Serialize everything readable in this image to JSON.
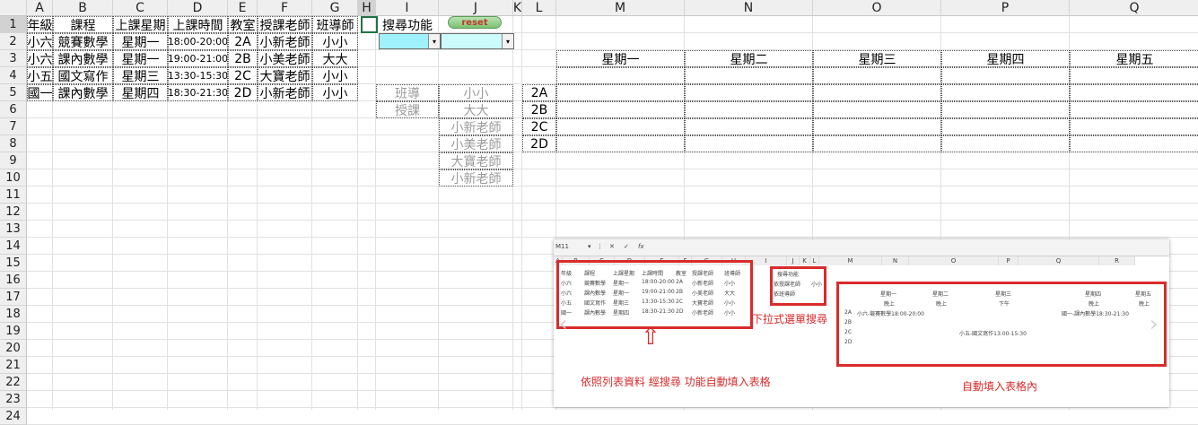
{
  "columns": [
    "A",
    "B",
    "C",
    "D",
    "E",
    "F",
    "G",
    "H",
    "I",
    "J",
    "K",
    "L",
    "M",
    "N",
    "O",
    "P",
    "Q"
  ],
  "rows": [
    "1",
    "2",
    "3",
    "4",
    "5",
    "6",
    "7",
    "8",
    "9",
    "10",
    "11",
    "12",
    "13",
    "14",
    "15",
    "16",
    "17",
    "18",
    "19",
    "20",
    "21",
    "22",
    "23",
    "24"
  ],
  "table": {
    "headers": [
      "年級",
      "課程",
      "上課星期",
      "上課時間",
      "教室",
      "授課老師",
      "班導師"
    ],
    "rows": [
      [
        "小六",
        "競賽數學",
        "星期一",
        "18:00-20:00",
        "2A",
        "小新老師",
        "小小"
      ],
      [
        "小六",
        "課內數學",
        "星期一",
        "19:00-21:00",
        "2B",
        "小美老師",
        "大大"
      ],
      [
        "小五",
        "國文寫作",
        "星期三",
        "13:30-15:30",
        "2C",
        "大寶老師",
        "小小"
      ],
      [
        "國一",
        "課內數學",
        "星期四",
        "18:30-21:30",
        "2D",
        "小新老師",
        "小小"
      ]
    ]
  },
  "search": {
    "label": "搜尋功能",
    "reset_label": "reset",
    "dropdown_arrow": "▾"
  },
  "lists": {
    "types": [
      "班導",
      "授課"
    ],
    "teachers": [
      "小小",
      "大大",
      "小新老師",
      "小美老師",
      "大寶老師",
      "小新老師"
    ]
  },
  "schedule": {
    "days": [
      "星期一",
      "星期二",
      "星期三",
      "星期四",
      "星期五"
    ],
    "rooms": [
      "2A",
      "2B",
      "2C",
      "2D"
    ]
  },
  "inset": {
    "name_box": "M11",
    "formula_icons": [
      "▾",
      "⋮",
      "✕",
      "✓",
      "fx"
    ],
    "col_headers": [
      "A",
      "B",
      "C",
      "D",
      "E",
      "F",
      "G",
      "H",
      "I",
      "J",
      "K",
      "L",
      "M",
      "N",
      "O",
      "P",
      "Q",
      "R"
    ],
    "table_headers": [
      "年級",
      "課程",
      "上課星期",
      "上課時間",
      "教室",
      "授課老師",
      "班導師"
    ],
    "table_rows": [
      [
        "小六",
        "競賽數學",
        "星期一",
        "18:00-20:00",
        "2A",
        "小新老師",
        "小小"
      ],
      [
        "小六",
        "課內數學",
        "星期一",
        "19:00-21:00",
        "2B",
        "小美老師",
        "大大"
      ],
      [
        "小五",
        "國文寫作",
        "星期三",
        "13:30-15:30",
        "2C",
        "大寶老師",
        "小小"
      ],
      [
        "國一",
        "課內數學",
        "星期四",
        "18:30-21:30",
        "2D",
        "小新老師",
        "小小"
      ]
    ],
    "search_label": "搜尋功能",
    "search_row1": [
      "依授課老師",
      "小小"
    ],
    "search_row2": "依班導師",
    "days": [
      "星期一",
      "星期二",
      "星期三",
      "星期四",
      "星期五"
    ],
    "periods": [
      "晚上",
      "晚上",
      "下午",
      "晚上",
      "晚上"
    ],
    "rooms": [
      "2A",
      "2B",
      "2C",
      "2D"
    ],
    "entry_2a": "小六-競賽數學18:00-20:00",
    "entry_2a_thu": "國一-課內數學18:30-21:30",
    "entry_2c": "小五-國文寫作13:00-15:30",
    "caption_left": "依照列表資料 經搜尋 功能自動填入表格",
    "caption_mid": "下拉式選單搜尋",
    "caption_right": "自動填入表格內",
    "nav_prev": "‹",
    "nav_next": "›",
    "arrow_up": "⇧",
    "accent_color": "#d92b2b"
  }
}
